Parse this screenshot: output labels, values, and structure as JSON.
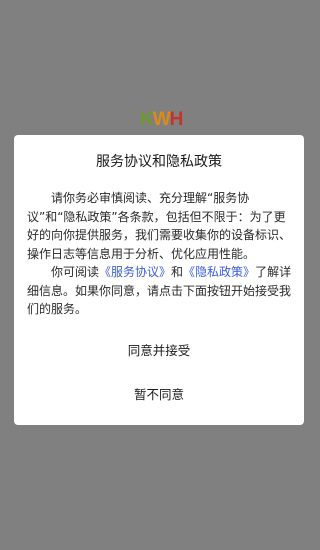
{
  "splash": {
    "logo": {
      "k": "K",
      "w": "W",
      "h": "H",
      "colors": {
        "k": "#6e9a2a",
        "w": "#e08a16",
        "h": "#c4342a"
      }
    }
  },
  "dialog": {
    "title": "服务协议和隐私政策",
    "paragraph1": "请你务必审慎阅读、充分理解“服务协议”和“隐私政策”各条款，包括但不限于：为了更好的向你提供服务，我们需要收集你的设备标识、操作日志等信息用于分析、优化应用性能。",
    "paragraph2": {
      "prefix": "你可阅读",
      "service_link": "《服务协议》",
      "middle": "和",
      "privacy_link": "《隐私政策》",
      "suffix": "了解详细信息。如果你同意，请点击下面按钮开始接受我们的服务。"
    },
    "agree_label": "同意并接受",
    "disagree_label": "暂不同意"
  },
  "colors": {
    "overlay": "#808080",
    "dialog_bg": "#ffffff",
    "link": "#3a5dd8",
    "text": "#2a2a2a"
  }
}
